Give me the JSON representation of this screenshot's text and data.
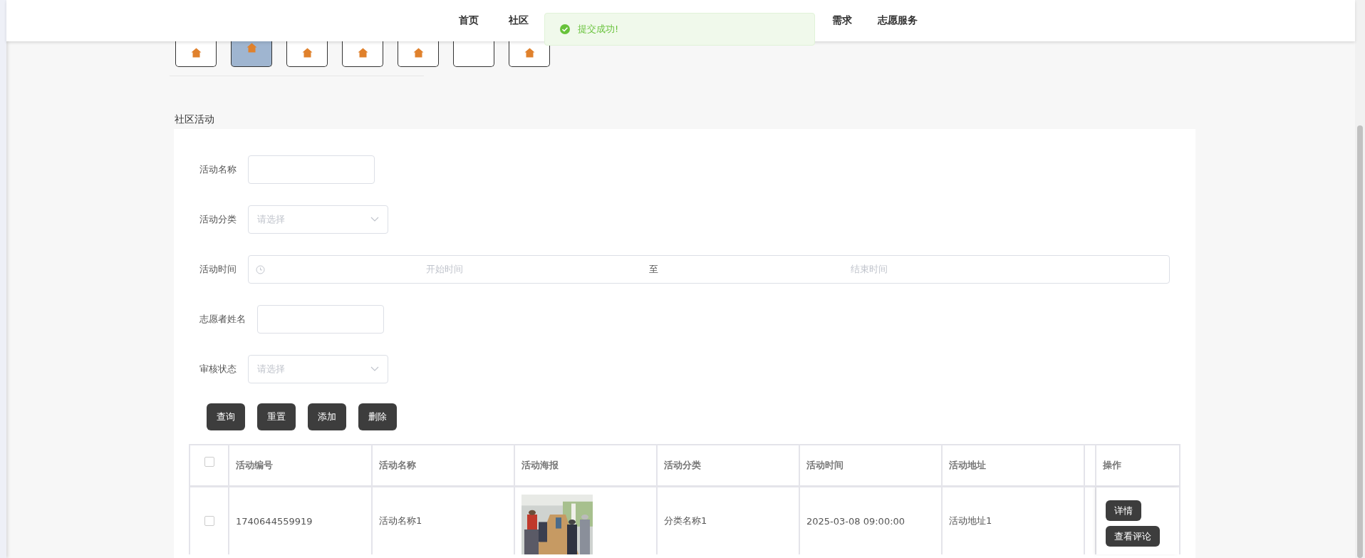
{
  "nav": {
    "items": [
      {
        "label": "首页"
      },
      {
        "label": "社区"
      },
      {
        "label": "需求"
      },
      {
        "label": "志愿服务"
      }
    ]
  },
  "toast": {
    "kind": "success",
    "text": "提交成功!"
  },
  "category_tiles": [
    {
      "selected": false,
      "has_icon": true
    },
    {
      "selected": true,
      "has_icon": true
    },
    {
      "selected": false,
      "has_icon": true
    },
    {
      "selected": false,
      "has_icon": true
    },
    {
      "selected": false,
      "has_icon": true
    },
    {
      "selected": false,
      "has_icon": false
    },
    {
      "selected": false,
      "has_icon": true
    }
  ],
  "section_title": "社区活动",
  "search_form": {
    "fields": [
      {
        "kind": "text",
        "label": "活动名称"
      },
      {
        "kind": "select",
        "label": "活动分类",
        "placeholder": "请选择"
      },
      {
        "kind": "daterange",
        "label": "活动时间",
        "start_placeholder": "开始时间",
        "separator": "至",
        "end_placeholder": "结束时间"
      },
      {
        "kind": "text",
        "label": "志愿者姓名"
      },
      {
        "kind": "select",
        "label": "审核状态",
        "placeholder": "请选择"
      }
    ],
    "buttons": [
      "查询",
      "重置",
      "添加",
      "删除"
    ]
  },
  "table": {
    "columns": [
      "活动编号",
      "活动名称",
      "活动海报",
      "活动分类",
      "活动时间",
      "活动地址",
      "操作"
    ],
    "header_checked": false,
    "rows": [
      {
        "checked": false,
        "id": "1740644559919",
        "name": "活动名称1",
        "category": "分类名称1",
        "time": "2025-03-08 09:00:00",
        "address": "活动地址1",
        "actions": [
          "详情",
          "查看评论"
        ]
      }
    ]
  }
}
